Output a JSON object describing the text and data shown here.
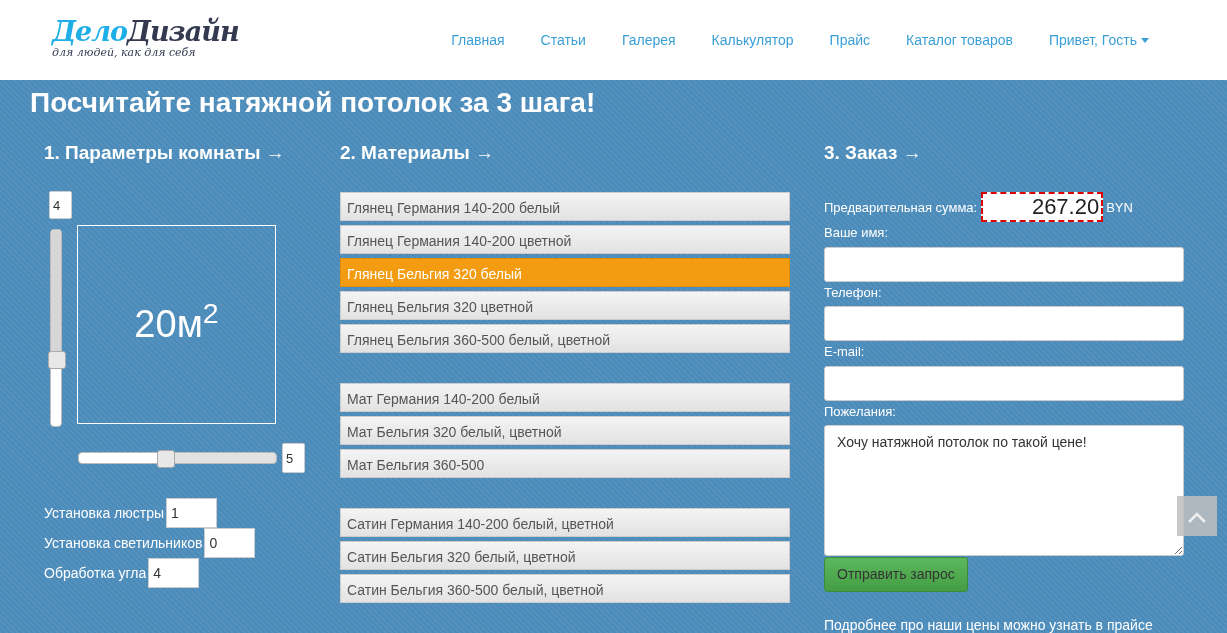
{
  "logo": {
    "first": "Дело",
    "second": "Дизайн",
    "tagline": "для людей, как для себя"
  },
  "nav": [
    {
      "label": "Главная",
      "dropdown": false
    },
    {
      "label": "Статьи",
      "dropdown": false
    },
    {
      "label": "Галерея",
      "dropdown": false
    },
    {
      "label": "Калькулятор",
      "dropdown": false
    },
    {
      "label": "Прайс",
      "dropdown": false
    },
    {
      "label": "Каталог товаров",
      "dropdown": false
    },
    {
      "label": "Привет, Гость",
      "dropdown": true
    }
  ],
  "title": "Посчитайте натяжной потолок за 3 шага!",
  "room": {
    "heading": "1. Параметры комнаты →",
    "width": {
      "value": "4",
      "level": 0.34
    },
    "length": {
      "value": "5",
      "level": 0.44
    },
    "area": "20м$^{2}$",
    "extras": [
      {
        "label": "Установка люстры",
        "value": "1"
      },
      {
        "label": "Установка светильников",
        "value": "0"
      },
      {
        "label": "Обработка угла",
        "value": "4"
      }
    ]
  },
  "materials": {
    "heading": "2. Материалы →",
    "groups": [
      [
        {
          "label": "Глянец Германия 140-200 белый",
          "selected": false
        },
        {
          "label": "Глянец Германия 140-200 цветной",
          "selected": false
        },
        {
          "label": "Глянец Бельгия 320 белый",
          "selected": true
        },
        {
          "label": "Глянец Бельгия 320 цветной",
          "selected": false
        },
        {
          "label": "Глянец Бельгия 360-500 белый, цветной",
          "selected": false
        }
      ],
      [
        {
          "label": "Мат Германия 140-200 белый",
          "selected": false
        },
        {
          "label": "Мат Бельгия 320 белый, цветной",
          "selected": false
        },
        {
          "label": "Мат Бельгия 360-500",
          "selected": false
        }
      ],
      [
        {
          "label": "Сатин Германия 140-200 белый, цветной",
          "selected": false
        },
        {
          "label": "Сатин Бельгия 320 белый, цветной",
          "selected": false
        },
        {
          "label": "Сатин Бельгия 360-500 белый, цветной",
          "selected": false
        }
      ]
    ]
  },
  "order": {
    "heading": "3. Заказ →",
    "sum_label": "Предварительная сумма:",
    "sum": "267.20",
    "currency": "BYN",
    "fields": [
      {
        "label": "Ваше имя:",
        "kind": "input"
      },
      {
        "label": "Телефон:",
        "kind": "input"
      },
      {
        "label": "E-mail:",
        "kind": "input"
      },
      {
        "label": "Пожелания:",
        "kind": "textarea",
        "value": "Хочу натяжной потолок по такой цене!"
      }
    ],
    "submit": "Отправить запрос",
    "note": "Подробнее про наши цены можно узнать в прайсе"
  }
}
